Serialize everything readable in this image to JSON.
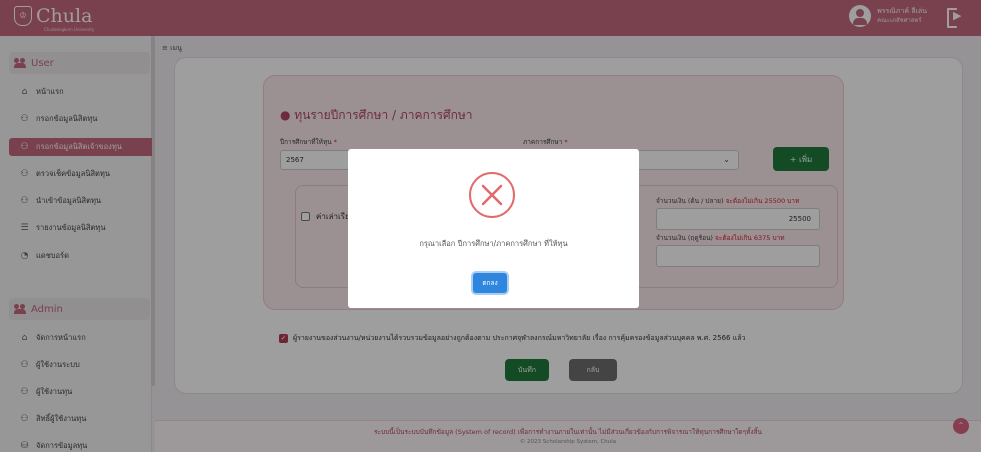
{
  "header": {
    "logo_text": "Chula",
    "logo_sub": "Chulalongkorn University",
    "user_name": "พรรณิภาค์ ลีเล่น",
    "user_dept": "คณะเภสัชศาสตร์"
  },
  "breadcrumb": "≡ เมนู",
  "sidebar": {
    "user_group": "User",
    "user_items": [
      {
        "label": "หน้าแรก",
        "icon": "home-icon"
      },
      {
        "label": "กรอกข้อมูลนิสิตทุน",
        "icon": "user-icon"
      },
      {
        "label": "กรอกข้อมูลนิสิตเจ้าของทุน",
        "icon": "user-icon"
      },
      {
        "label": "ตรวจเช็คข้อมูลนิสิตทุน",
        "icon": "user-icon"
      },
      {
        "label": "นำเข้าข้อมูลนิสิตทุน",
        "icon": "user-icon"
      },
      {
        "label": "รายงานข้อมูลนิสิตทุน",
        "icon": "report-icon"
      },
      {
        "label": "แดชบอร์ด",
        "icon": "dashboard-icon"
      }
    ],
    "admin_group": "Admin",
    "admin_items": [
      {
        "label": "จัดการหน้าแรก",
        "icon": "home-icon"
      },
      {
        "label": "ผู้ใช้งานระบบ",
        "icon": "user-icon"
      },
      {
        "label": "ผู้ใช้งานทุน",
        "icon": "user-icon"
      },
      {
        "label": "สิทธิ์ผู้ใช้งานทุน",
        "icon": "user-icon"
      },
      {
        "label": "จัดการข้อมูลทุน",
        "icon": "database-icon"
      }
    ]
  },
  "form": {
    "section_title": "● ทุนรายปีการศึกษา / ภาคการศึกษา",
    "year_label": "ปีการศึกษาที่ให้ทุน",
    "year_value": "2567",
    "term_label": "ภาคการศึกษา",
    "term_value": "",
    "add_button": "+ เพิ่ม",
    "item_label": "ค่าเล่าเรียน",
    "amount_label": "จำนวนเงิน (ต้น / ปลาย)",
    "amount_note": "จะต้องไม่เกิน 25500 บาท",
    "amount_value": "25500",
    "amount2_label": "จำนวนเงิน (ฤดูร้อน)",
    "amount2_note": "จะต้องไม่เกิน 6375 บาท",
    "amount2_value": "",
    "consent_text": "ผู้รายงานของส่วนงาน/หน่วยงานได้รวบรวมข้อมูลอย่างถูกต้องตาม ประกาศจุฬาลงกรณ์มหาวิทยาลัย เรื่อง การคุ้มครองข้อมูลส่วนบุคคล พ.ศ. 2566 แล้ว",
    "save_button": "บันทึก",
    "back_button": "กลับ"
  },
  "footer": {
    "notice": "ระบบนี้เป็นระบบบันทึกข้อมูล (System of record) เพื่อการทำงานภายในเท่านั้น ไม่มีส่วนเกี่ยวข้องกับการพิจารณาให้ทุนการศึกษาใดๆทั้งสิ้น",
    "copyright": "© 2023 Scholarship System, Chula"
  },
  "modal": {
    "message": "กรุณาเลือก ปีการศึกษา/ภาคการศึกษา ที่ให้ทุน",
    "ok_button": "ตกลง"
  },
  "colors": {
    "brand": "#c4687d",
    "success": "#1f7a3a",
    "error": "#e26a6a",
    "primary": "#2e86de"
  }
}
